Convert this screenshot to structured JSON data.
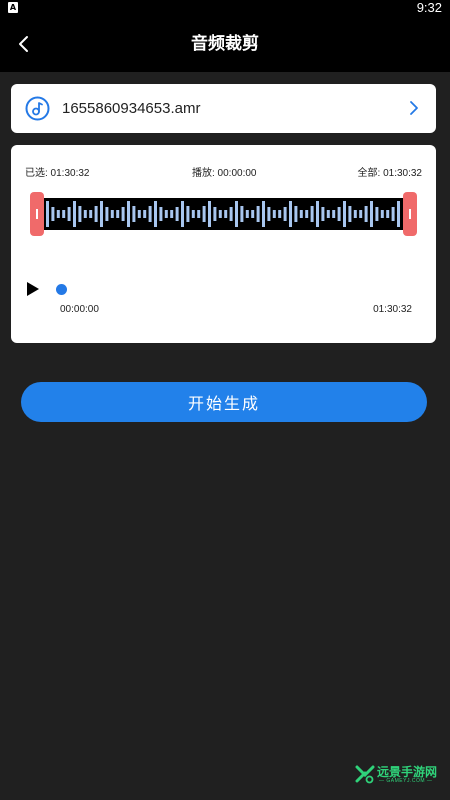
{
  "status_bar": {
    "app_icon_letter": "A",
    "time": "9:32"
  },
  "app_bar": {
    "title": "音频裁剪",
    "back_icon": "chevron-left-icon"
  },
  "file": {
    "icon": "music-note-icon",
    "name": "1655860934653.amr",
    "open_icon": "chevron-right-icon"
  },
  "trim": {
    "selected_label": "已选: 01:30:32",
    "playing_label": "播放: 00:00:00",
    "total_label": "全部: 01:30:32",
    "start_time": "00:00:00",
    "end_time": "01:30:32",
    "progress": 0,
    "selection_start": 0,
    "selection_end": 1,
    "handle_color": "#f06a6a",
    "wave_color": "#a8c6ef"
  },
  "actions": {
    "generate_label": "开始生成"
  },
  "watermark": {
    "name": "远景手游网",
    "domain": "— GAMEYJ.COM —",
    "color": "#2fd37a"
  },
  "colors": {
    "background": "#202020",
    "accent": "#2281ea"
  }
}
